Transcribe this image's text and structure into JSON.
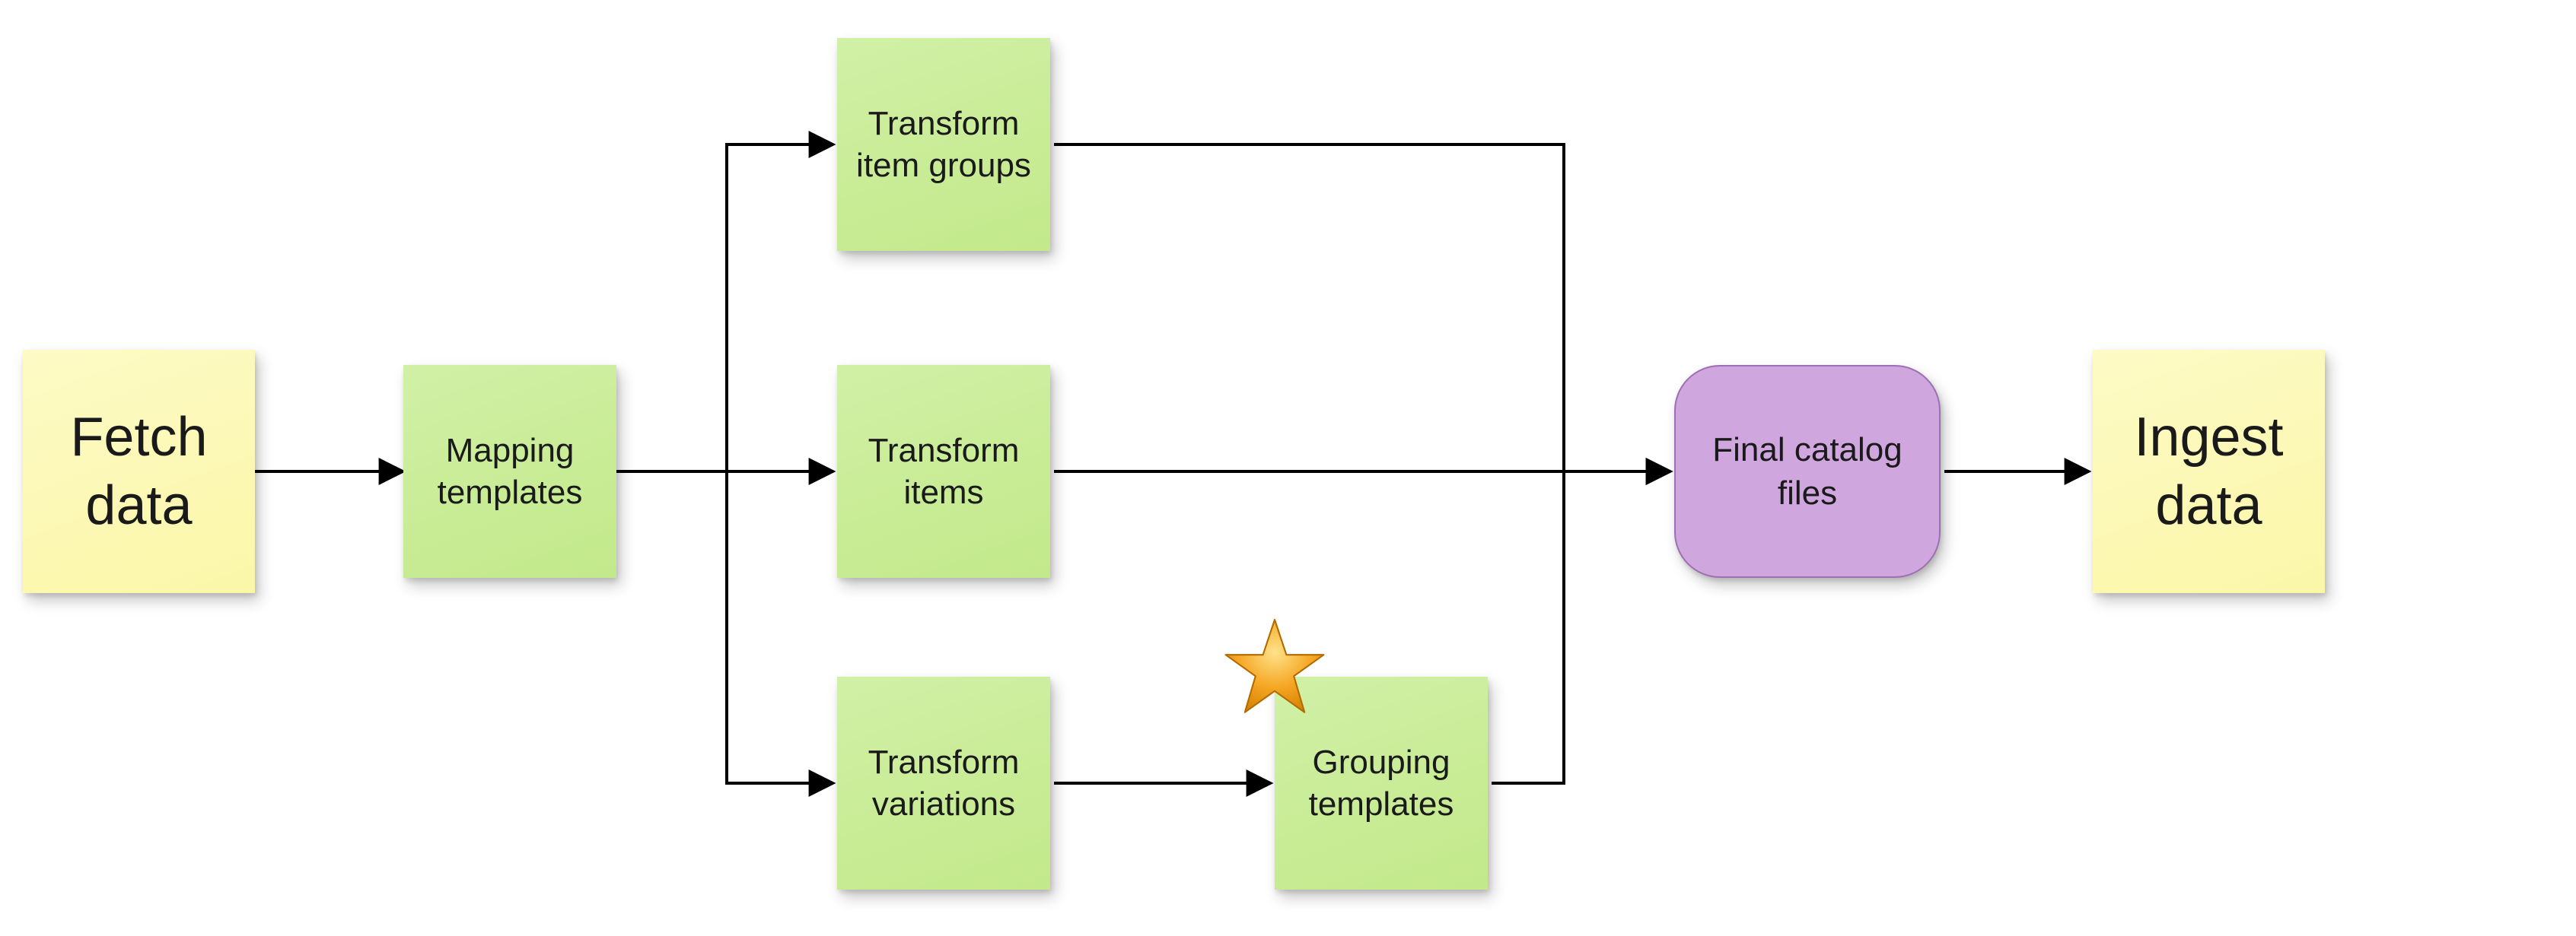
{
  "nodes": {
    "fetch_data": {
      "label": "Fetch data",
      "color": "yellow",
      "font_size": 72
    },
    "mapping_templates": {
      "label": "Mapping templates",
      "color": "green",
      "font_size": 44
    },
    "transform_item_groups": {
      "label": "Transform item groups",
      "color": "green",
      "font_size": 44
    },
    "transform_items": {
      "label": "Transform items",
      "color": "green",
      "font_size": 44
    },
    "transform_variations": {
      "label": "Transform variations",
      "color": "green",
      "font_size": 44
    },
    "grouping_templates": {
      "label": "Grouping templates",
      "color": "green",
      "font_size": 44,
      "starred": true
    },
    "final_catalog_files": {
      "label": "Final catalog files",
      "color": "purple",
      "font_size": 44
    },
    "ingest_data": {
      "label": "Ingest data",
      "color": "yellow",
      "font_size": 72
    }
  },
  "edges": [
    [
      "fetch_data",
      "mapping_templates"
    ],
    [
      "mapping_templates",
      "transform_item_groups"
    ],
    [
      "mapping_templates",
      "transform_items"
    ],
    [
      "mapping_templates",
      "transform_variations"
    ],
    [
      "transform_item_groups",
      "final_catalog_files"
    ],
    [
      "transform_items",
      "final_catalog_files"
    ],
    [
      "transform_variations",
      "grouping_templates"
    ],
    [
      "grouping_templates",
      "final_catalog_files"
    ],
    [
      "final_catalog_files",
      "ingest_data"
    ]
  ],
  "colors": {
    "yellow": "#fbf7a8",
    "green": "#c6eb90",
    "purple": "#cfa6dd",
    "arrow": "#000000"
  }
}
